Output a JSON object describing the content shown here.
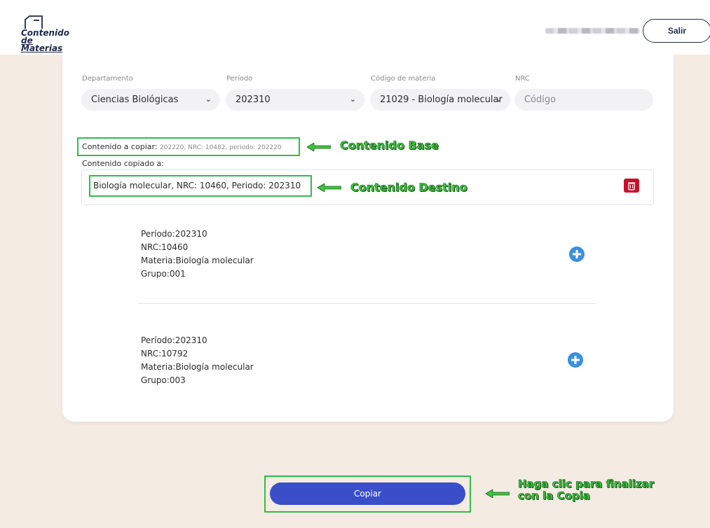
{
  "header": {
    "logo_line1": "Contenido",
    "logo_line2": "de Materias",
    "logout_label": "Salir"
  },
  "filters": {
    "departamento": {
      "label": "Departamento",
      "value": "Ciencias Biológicas"
    },
    "periodo": {
      "label": "Período",
      "value": "202310"
    },
    "codigo": {
      "label": "Código de materia",
      "value": "21029 - Biología molecular"
    },
    "nrc": {
      "label": "NRC",
      "placeholder": "Código"
    }
  },
  "copy_info": {
    "source_label": "Contenido a copiar:",
    "source_value": "202220, NRC: 10482, periodo: 202220",
    "dest_label": "Contenido copiado a:",
    "dest_value": "Biología molecular, NRC: 10460, Periodo: 202310"
  },
  "courses": [
    {
      "periodo": "Período:202310",
      "nrc": "NRC:10460",
      "materia": "Materia:Biología molecular",
      "grupo": "Grupo:001"
    },
    {
      "periodo": "Período:202310",
      "nrc": "NRC:10792",
      "materia": "Materia:Biología molecular",
      "grupo": "Grupo:003"
    }
  ],
  "actions": {
    "copy_label": "Copiar"
  },
  "annotations": {
    "base": "Contenido Base",
    "destino": "Contenido Destino",
    "finalizar_line1": "Haga clic para finalizar",
    "finalizar_line2": "con la Copia"
  },
  "colors": {
    "accent": "#3a4fc7",
    "annotation_green": "#2ebd4a",
    "delete_red": "#c8102e",
    "plus_blue": "#3b8fe0"
  }
}
